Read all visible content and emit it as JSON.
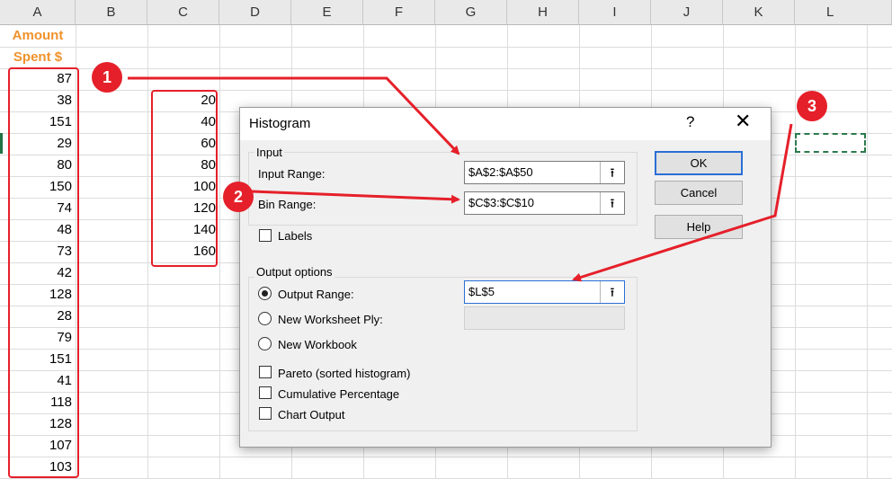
{
  "columns": [
    "A",
    "B",
    "C",
    "D",
    "E",
    "F",
    "G",
    "H",
    "I",
    "J",
    "K",
    "L"
  ],
  "column_a": {
    "header_line1": "Amount",
    "header_line2": "Spent $",
    "values": [
      "87",
      "38",
      "151",
      "29",
      "80",
      "150",
      "74",
      "48",
      "73",
      "42",
      "128",
      "28",
      "79",
      "151",
      "41",
      "118",
      "128",
      "107",
      "103"
    ]
  },
  "column_c": {
    "values": [
      "20",
      "40",
      "60",
      "80",
      "100",
      "120",
      "140",
      "160"
    ]
  },
  "dialog": {
    "title": "Histogram",
    "help_glyph": "?",
    "close_glyph": "✕",
    "input_group": "Input",
    "input_range_label": "Input Range:",
    "input_range_value": "$A$2:$A$50",
    "bin_range_label": "Bin Range:",
    "bin_range_value": "$C$3:$C$10",
    "labels_label": "Labels",
    "output_group": "Output options",
    "output_range_label": "Output Range:",
    "output_range_value": "$L$5",
    "new_sheet_label": "New Worksheet Ply:",
    "new_sheet_value": "",
    "new_workbook_label": "New Workbook",
    "pareto_label": "Pareto (sorted histogram)",
    "cumulative_label": "Cumulative Percentage",
    "chart_output_label": "Chart Output",
    "ok_label": "OK",
    "cancel_label": "Cancel",
    "help_label": "Help",
    "picker_glyph": "⭱",
    "output_selected": "output-range"
  },
  "callouts": [
    "1",
    "2",
    "3"
  ],
  "colors": {
    "accent_red": "#e5202a",
    "header_orange": "#f0922c",
    "selection_green": "#2a7a4b"
  }
}
